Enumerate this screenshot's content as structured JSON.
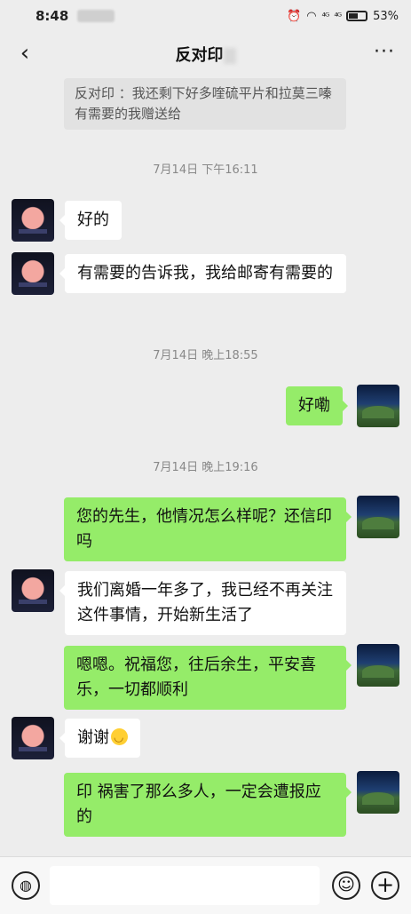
{
  "status_bar": {
    "time": "8:48",
    "signal1": "⁴ᴳ",
    "signal2": "⁴ᴳ",
    "battery": "53%"
  },
  "header": {
    "title": "反对印",
    "back_icon": "chevron-left-icon",
    "more_label": "···"
  },
  "quote": {
    "text": "反对印    ：我还剩下好多喹硫平片和拉莫三嗪有需要的我赠送给"
  },
  "timestamps": [
    "7月14日 下午16:11",
    "7月14日 晚上18:55",
    "7月14日 晚上19:16"
  ],
  "messages": [
    {
      "side": "in",
      "text": "好的"
    },
    {
      "side": "in",
      "text": "有需要的告诉我，我给邮寄有需要的"
    },
    {
      "side": "out",
      "text": "好嘞"
    },
    {
      "side": "out",
      "text": "您的先生，他情况怎么样呢？还信印    吗"
    },
    {
      "side": "in",
      "text": "我们离婚一年多了，我已经不再关注这件事情，开始新生活了"
    },
    {
      "side": "out",
      "text": "嗯嗯。祝福您，往后余生，平安喜乐，一切都顺利"
    },
    {
      "side": "in",
      "text": "谢谢"
    },
    {
      "side": "out",
      "text": "印    祸害了那么多人，一定会遭报应的"
    }
  ],
  "input_bar": {
    "voice_icon": "voice-icon",
    "emoji_icon": "emoji-icon",
    "plus_icon": "plus-icon"
  }
}
